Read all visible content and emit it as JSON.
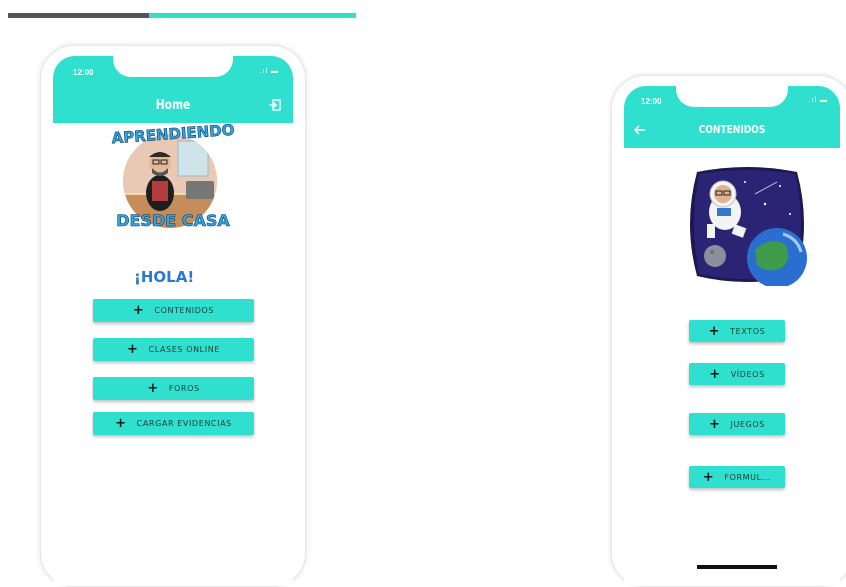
{
  "colors": {
    "accent": "#2fe0cf",
    "hola": "#2d76d3"
  },
  "progress": {
    "fraction": 0.6
  },
  "phone1": {
    "status_time": "12:00",
    "title": "Home",
    "logout_icon": "logout-icon",
    "logo": {
      "top_text": "APRENDIENDO",
      "bottom_text": "DESDE CASA"
    },
    "greeting": "¡HOLA!",
    "buttons": [
      {
        "label": "CONTENIDOS"
      },
      {
        "label": "CLASES ONLINE"
      },
      {
        "label": "FOROS"
      },
      {
        "label": "CARGAR EVIDENCIAS"
      }
    ]
  },
  "phone2": {
    "status_time": "12:00",
    "title": "CONTENIDOS",
    "back_icon": "arrow-left-icon",
    "image": "astronaut-earth-image",
    "buttons": [
      {
        "label": "TEXTOS"
      },
      {
        "label": "VÍDEOS"
      },
      {
        "label": "JUEGOS"
      },
      {
        "label": "FORMUL..."
      }
    ]
  }
}
